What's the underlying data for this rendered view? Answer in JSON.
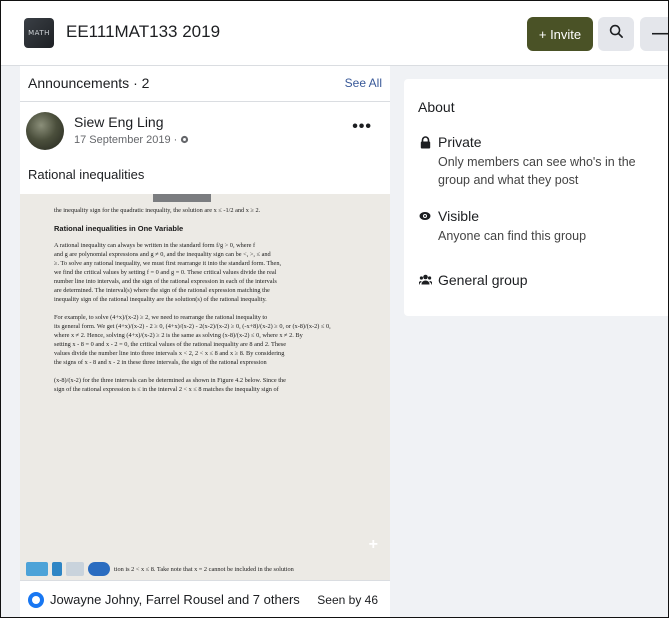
{
  "header": {
    "group_name": "EE111MAT133 2019",
    "thumb_label": "MATH",
    "invite_label": "+ Invite",
    "search_icon": "search-icon",
    "more_icon": "more-icon"
  },
  "announcements": {
    "title": "Announcements · 2",
    "see_all": "See All"
  },
  "post": {
    "author": "Siew Eng Ling",
    "date": "17 September 2019 ·",
    "privacy_icon": "globe-icon",
    "text": "Rational inequalities",
    "reactors": "Jowayne Johny, Farrel Rousel and 7 others",
    "seen_by": "Seen by 46"
  },
  "document": {
    "top_line": "the inequality sign for the quadratic inequality, the solution are x ≤ -1/2 and x ≥ 2.",
    "heading": "Rational inequalities in One Variable",
    "lines": [
      "A rational inequality can always be written in the standard form  f/g > 0, where f",
      "and g are polynomial expressions and g ≠ 0, and the inequality sign can be <, >, ≤ and",
      "≥. To solve any rational inequality, we must first rearrange it into the standard form. Then,",
      "we find the critical values by setting f = 0 and g = 0. These critical values divide the real",
      "number line into intervals, and the sign of the rational expression in each of the intervals",
      "are determined. The interval(s) where the sign of the rational expression matching the",
      "inequality sign of the rational inequality are the solution(s) of the rational inequality.",
      "",
      "For example, to solve (4+x)/(x-2) ≥ 2, we need to rearrange the rational inequality to",
      "its general form. We get (4+x)/(x-2) - 2 ≥ 0, (4+x)/(x-2) - 2(x-2)/(x-2) ≥ 0, (-x+8)/(x-2) ≥ 0, or (x-8)/(x-2) ≤ 0,",
      "where x ≠ 2. Hence, solving (4+x)/(x-2) ≥ 2 is the same as solving (x-8)/(x-2) ≤ 0, where x ≠ 2. By",
      "setting x - 8 = 0 and x - 2 = 0, the critical values of the rational inequality are 8 and 2. These",
      "values divide the number line into three intervals x < 2, 2 < x ≤ 8 and x ≥ 8. By considering",
      "the signs of x - 8 and x - 2 in these three intervals, the sign of the rational expression",
      "",
      "(x-8)/(x-2) for the three intervals can be determined as shown in Figure 4.2 below. Since the",
      "sign of the rational expression is ≤ in the interval 2 < x ≤ 8 matches the inequality sign of"
    ],
    "toolbar_text": "tion is 2 < x ≤ 8. Take note that x = 2 cannot be included in the solution"
  },
  "about": {
    "title": "About",
    "private_title": "Private",
    "private_desc": "Only members can see who's in the group and what they post",
    "visible_title": "Visible",
    "visible_desc": "Anyone can find this group",
    "general_title": "General group"
  },
  "colors": {
    "invite_bg": "#4a5226",
    "link": "#385898",
    "reaction": "#1877f2",
    "page_bg": "#f0f2f5"
  }
}
